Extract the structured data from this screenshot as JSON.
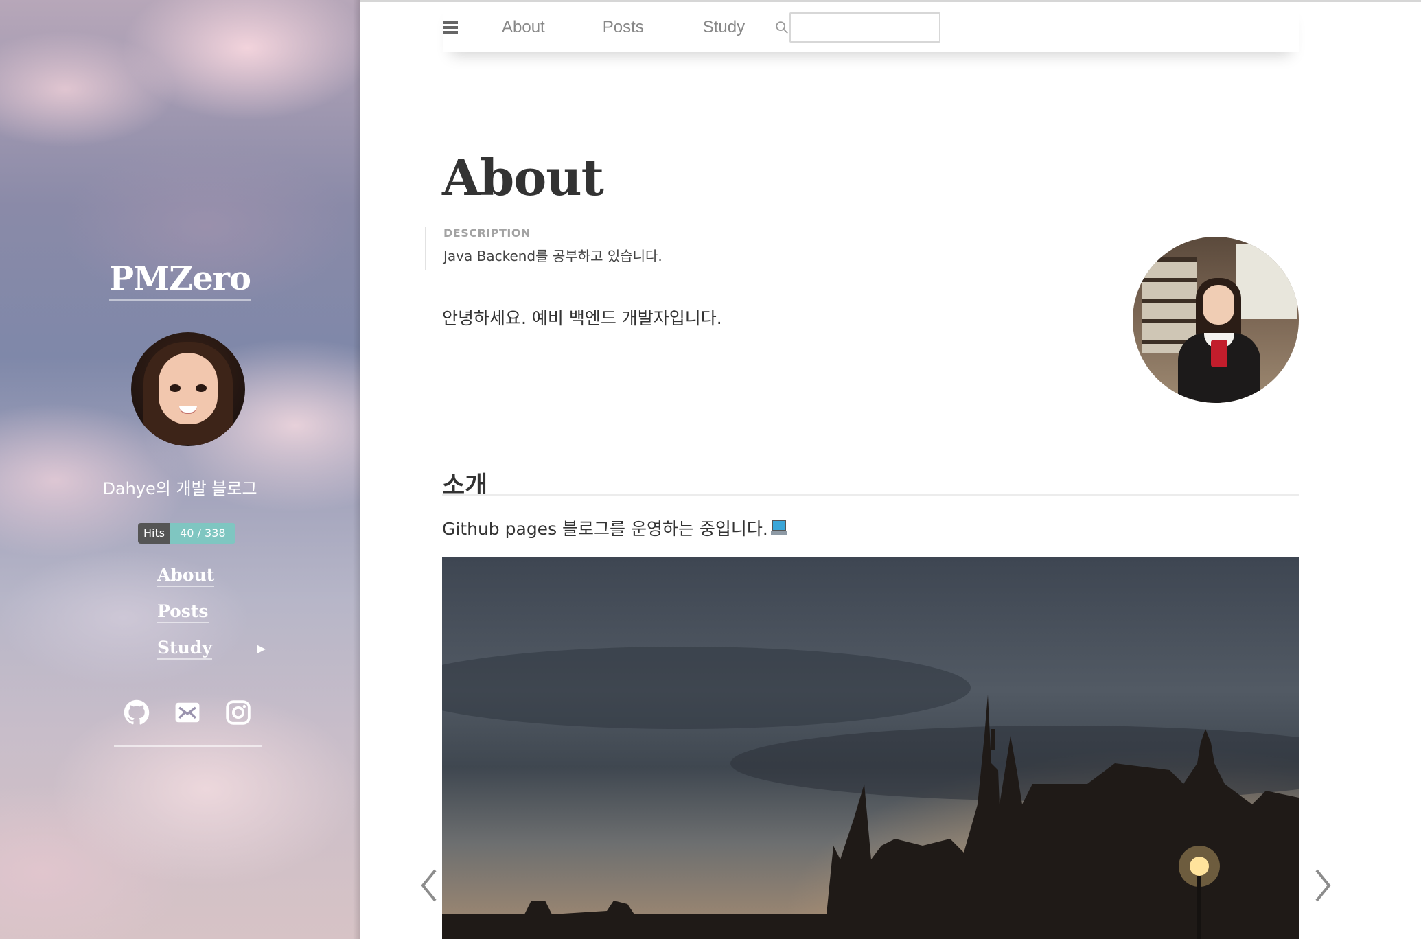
{
  "sidebar": {
    "site_title": "PMZero",
    "tagline": "Dahye의 개발 블로그",
    "hits": {
      "label": "Hits",
      "value": "40 / 338"
    },
    "nav": [
      {
        "label": "About"
      },
      {
        "label": "Posts"
      },
      {
        "label": "Study",
        "has_submenu": true,
        "submenu_icon": "chevron-right-icon"
      }
    ],
    "social_icons": [
      "github-icon",
      "email-icon",
      "instagram-icon"
    ]
  },
  "navbar": {
    "menu_icon": "hamburger-menu-icon",
    "links": [
      "About",
      "Posts",
      "Study"
    ],
    "search_icon": "search-icon",
    "search": {
      "value": "",
      "placeholder": ""
    }
  },
  "main": {
    "title": "About",
    "description_label": "DESCRIPTION",
    "description_text": "Java Backend를 공부하고 있습니다.",
    "greeting": "안녕하세요. 예비 백엔드 개발자입니다.",
    "section_heading": "소개",
    "intro_text": "Github pages 블로그를 운영하는 중입니다.",
    "intro_emoji_icon": "laptop-icon",
    "carousel": {
      "prev_icon": "chevron-left-icon",
      "next_icon": "chevron-right-icon"
    }
  },
  "colors": {
    "accent_text": "#333333",
    "nav_text": "#888888",
    "hits_value_bg": "#7fc6c1",
    "hits_label_bg": "#555555",
    "sidebar_text": "#ffffff"
  }
}
